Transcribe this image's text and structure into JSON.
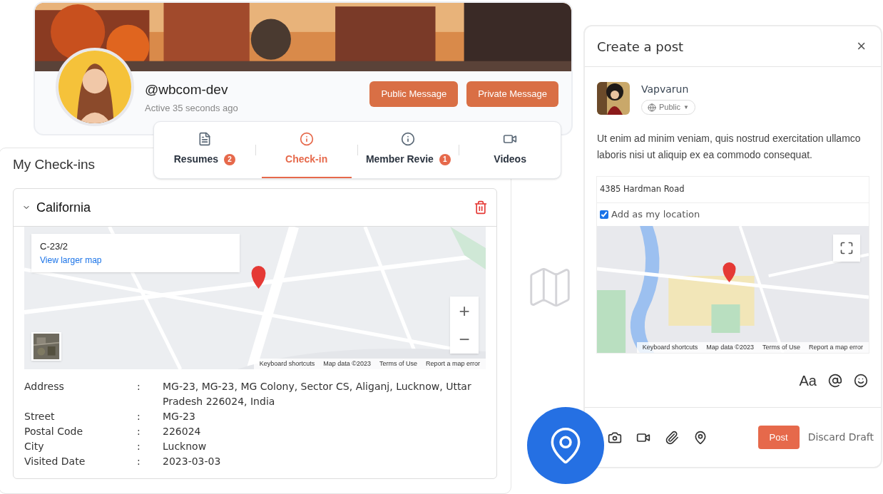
{
  "profile": {
    "handle": "@wbcom-dev",
    "status": "Active 35 seconds ago",
    "buttons": [
      "Public Message",
      "Private Message"
    ]
  },
  "tabs": [
    {
      "label": "Resumes",
      "kind": "document",
      "badge": "2",
      "selected": false
    },
    {
      "label": "Check-in",
      "kind": "info",
      "selected": true
    },
    {
      "label": "Member Revie",
      "kind": "info",
      "badge": "1",
      "selected": false
    },
    {
      "label": "Videos",
      "kind": "video",
      "selected": false
    }
  ],
  "checkins": {
    "title": "My Check-ins",
    "place": {
      "name": "California",
      "expanded": true
    },
    "map": {
      "card_title": "C-23/2",
      "card_link": "View larger map",
      "zoom": [
        "+",
        "−"
      ],
      "attribution": [
        "Keyboard shortcuts",
        "Map data ©2023",
        "Terms of Use",
        "Report a map error"
      ]
    },
    "details": [
      {
        "label": "Address",
        "sep": ":",
        "value": "MG-23, MG-23, MG Colony, Sector CS, Aliganj, Lucknow, Uttar Pradesh 226024, India"
      },
      {
        "label": "Street",
        "sep": ":",
        "value": "MG-23"
      },
      {
        "label": "Postal Code",
        "sep": ":",
        "value": "226024"
      },
      {
        "label": "City",
        "sep": ":",
        "value": "Lucknow"
      },
      {
        "label": "Visited Date",
        "sep": ":",
        "value": "2023-03-03"
      }
    ]
  },
  "post": {
    "title": "Create a post",
    "close": "×",
    "author": "Vapvarun",
    "privacy": "Public",
    "privacy_caret": "▼",
    "text": "Ut enim ad minim veniam, quis nostrud exercitation ullamco laboris nisi ut aliquip ex ea commodo consequat.",
    "location": {
      "value": "4385 Hardman Road",
      "checkbox": {
        "label": "Add as my location",
        "checked": true
      },
      "attribution": [
        "Keyboard shortcuts",
        "Map data ©2023",
        "Terms of Use",
        "Report a map error"
      ]
    },
    "format": "Aa",
    "submit": "Post",
    "discard": "Discard Draft"
  }
}
